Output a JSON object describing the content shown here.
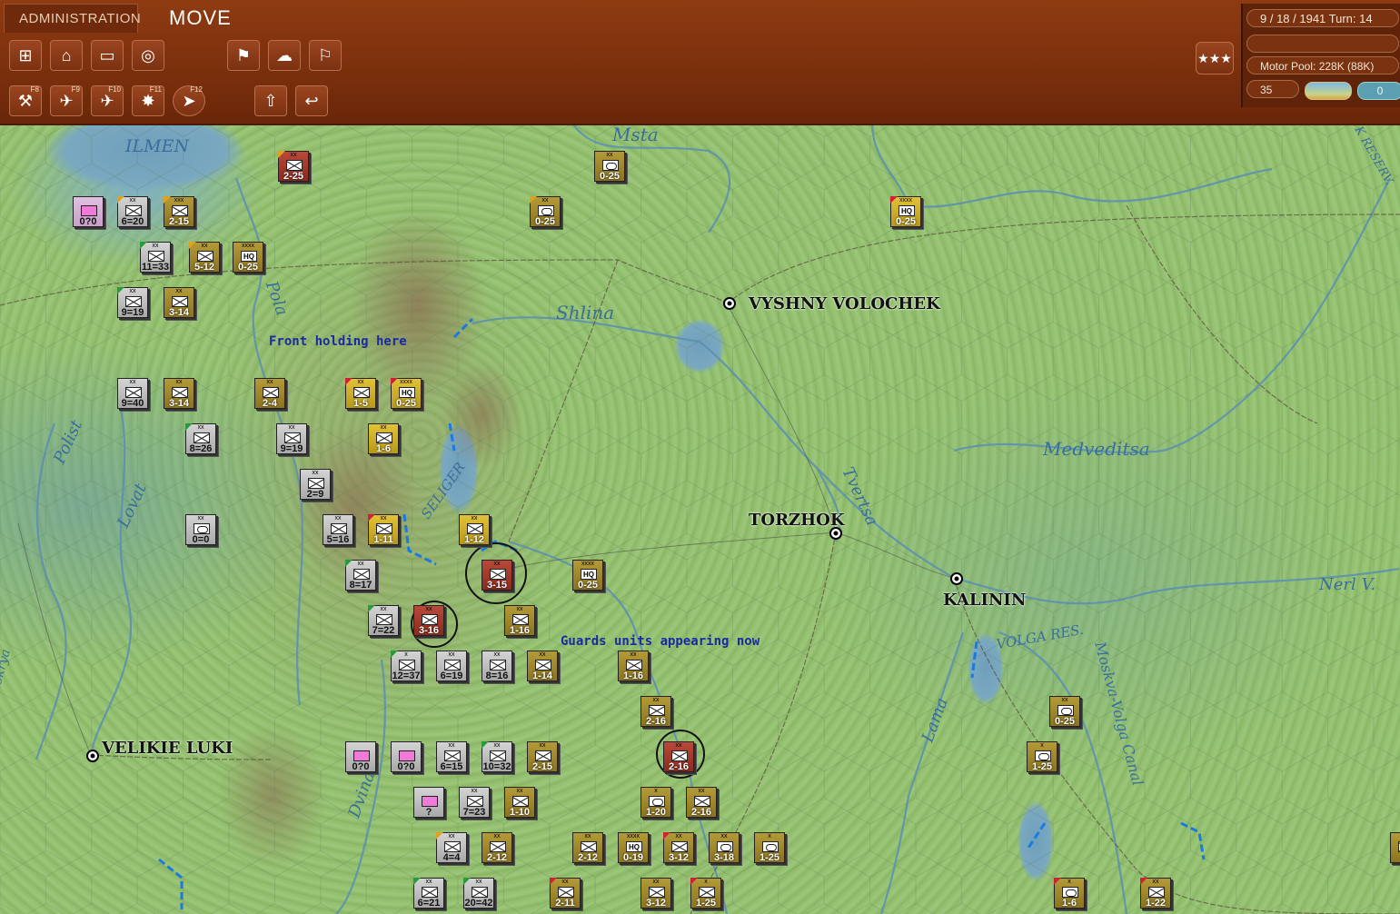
{
  "header": {
    "admin_tab": "ADMINISTRATION",
    "mode": "MOVE",
    "toolbar_row1": [
      {
        "name": "select-unit-icon",
        "glyph": "⊞"
      },
      {
        "name": "industry-icon",
        "glyph": "⌂"
      },
      {
        "name": "map-frame-icon",
        "glyph": "▭"
      },
      {
        "name": "zoom-target-icon",
        "glyph": "◎"
      },
      {
        "name": "reports-flag-icon",
        "glyph": "⚑"
      },
      {
        "name": "weather-icon",
        "glyph": "☁"
      },
      {
        "name": "victory-flag-icon",
        "glyph": "⚐"
      }
    ],
    "toolbar_row2": [
      {
        "name": "ground-attack-icon",
        "glyph": "⚒",
        "key": "F8"
      },
      {
        "name": "airborne-icon",
        "glyph": "✈",
        "key": "F9"
      },
      {
        "name": "air-strike-icon",
        "glyph": "✈",
        "key": "F10"
      },
      {
        "name": "bombard-icon",
        "glyph": "✸",
        "key": "F11"
      },
      {
        "name": "move-mode-icon",
        "glyph": "➤",
        "key": "F12"
      },
      {
        "name": "upload-icon",
        "glyph": "⇧",
        "key": ""
      },
      {
        "name": "undo-icon",
        "glyph": "↩",
        "key": ""
      }
    ],
    "stars": "★★★"
  },
  "info": {
    "turn": "9 / 18 / 1941  Turn: 14",
    "blank": "",
    "motor_pool": "Motor Pool:  228K (88K)",
    "number": "35",
    "water": "0"
  },
  "map": {
    "cities": [
      {
        "id": "vyshny-volochek",
        "label": "VYSHNY VOLOCHEK"
      },
      {
        "id": "torzhok",
        "label": "TORZHOK"
      },
      {
        "id": "kalinin",
        "label": "KALININ"
      },
      {
        "id": "velikie-luki",
        "label": "VELIKIE LUKI"
      }
    ],
    "rivers": [
      {
        "id": "ilmen",
        "label": "ILMEN"
      },
      {
        "id": "msta",
        "label": "Msta"
      },
      {
        "id": "shlina",
        "label": "Shlina"
      },
      {
        "id": "pola",
        "label": "Pola"
      },
      {
        "id": "polist",
        "label": "Polist"
      },
      {
        "id": "lovat",
        "label": "Lovat"
      },
      {
        "id": "seliger",
        "label": "SELIGER"
      },
      {
        "id": "tvertsa",
        "label": "Tvertsa"
      },
      {
        "id": "medveditsa",
        "label": "Medveditsa"
      },
      {
        "id": "nerl",
        "label": "Nerl V."
      },
      {
        "id": "volga",
        "label": "VOLGA RES."
      },
      {
        "id": "moskva-volga",
        "label": "Moskva-Volga Canal"
      },
      {
        "id": "lama",
        "label": "Lama"
      },
      {
        "id": "dvina",
        "label": "Dvina"
      },
      {
        "id": "rybinsk",
        "label": "K RESERV."
      },
      {
        "id": "lokrya",
        "label": "okrya"
      }
    ],
    "notes": [
      "Front holding here",
      "Guards units appearing now"
    ],
    "units": [
      {
        "c": "red",
        "t": "inf",
        "s": "2-25",
        "sz": "xx",
        "f": "gold"
      },
      {
        "c": "olive",
        "t": "arm",
        "s": "0-25",
        "sz": "xx",
        "f": ""
      },
      {
        "c": "pink",
        "t": "pink",
        "s": "0?0",
        "sz": "",
        "f": ""
      },
      {
        "c": "gray",
        "t": "inf",
        "s": "6=20",
        "sz": "xx",
        "f": "gold"
      },
      {
        "c": "olive",
        "t": "inf",
        "s": "2-15",
        "sz": "xxx",
        "f": "gold"
      },
      {
        "c": "olive",
        "t": "arm",
        "s": "0-25",
        "sz": "xx",
        "f": "gold"
      },
      {
        "c": "yellow",
        "t": "hq",
        "s": "0-25",
        "sz": "xxxx",
        "f": "red"
      },
      {
        "c": "gray",
        "t": "inf",
        "s": "11=33",
        "sz": "xx",
        "f": "green"
      },
      {
        "c": "olive",
        "t": "inf",
        "s": "5-12",
        "sz": "xx",
        "f": "gold"
      },
      {
        "c": "olive",
        "t": "hq",
        "s": "0-25",
        "sz": "xxxx",
        "f": ""
      },
      {
        "c": "gray",
        "t": "inf",
        "s": "9=19",
        "sz": "xx",
        "f": "green"
      },
      {
        "c": "olive",
        "t": "inf",
        "s": "3-14",
        "sz": "xx",
        "f": ""
      },
      {
        "c": "gray",
        "t": "inf",
        "s": "9=40",
        "sz": "xx",
        "f": ""
      },
      {
        "c": "olive",
        "t": "inf",
        "s": "3-14",
        "sz": "xx",
        "f": ""
      },
      {
        "c": "olive",
        "t": "inf",
        "s": "2-4",
        "sz": "xx",
        "f": ""
      },
      {
        "c": "yellow",
        "t": "inf",
        "s": "1-5",
        "sz": "xx",
        "f": "red"
      },
      {
        "c": "yellow",
        "t": "hq",
        "s": "0-25",
        "sz": "xxxx",
        "f": "red"
      },
      {
        "c": "gray",
        "t": "inf",
        "s": "8=26",
        "sz": "xx",
        "f": "green"
      },
      {
        "c": "gray",
        "t": "inf",
        "s": "9=19",
        "sz": "xx",
        "f": ""
      },
      {
        "c": "yellow",
        "t": "inf",
        "s": "1-6",
        "sz": "xx",
        "f": ""
      },
      {
        "c": "gray",
        "t": "inf",
        "s": "2=9",
        "sz": "xx",
        "f": ""
      },
      {
        "c": "gray",
        "t": "arm",
        "s": "0=0",
        "sz": "xx",
        "f": ""
      },
      {
        "c": "gray",
        "t": "inf",
        "s": "5=16",
        "sz": "xx",
        "f": ""
      },
      {
        "c": "yellow",
        "t": "inf",
        "s": "1-11",
        "sz": "xx",
        "f": "red"
      },
      {
        "c": "yellow",
        "t": "inf",
        "s": "1-12",
        "sz": "xx",
        "f": ""
      },
      {
        "c": "gray",
        "t": "inf",
        "s": "8=17",
        "sz": "xx",
        "f": "green"
      },
      {
        "c": "red",
        "t": "inf",
        "s": "3-15",
        "sz": "xx",
        "f": ""
      },
      {
        "c": "olive",
        "t": "hq",
        "s": "0-25",
        "sz": "xxxx",
        "f": ""
      },
      {
        "c": "gray",
        "t": "inf",
        "s": "7=22",
        "sz": "xx",
        "f": "green"
      },
      {
        "c": "red",
        "t": "inf",
        "s": "3-16",
        "sz": "xx",
        "f": ""
      },
      {
        "c": "olive",
        "t": "inf",
        "s": "1-16",
        "sz": "xx",
        "f": ""
      },
      {
        "c": "gray",
        "t": "inf",
        "s": "12=37",
        "sz": "x",
        "f": "green"
      },
      {
        "c": "gray",
        "t": "inf",
        "s": "6=19",
        "sz": "xx",
        "f": ""
      },
      {
        "c": "gray",
        "t": "inf",
        "s": "8=16",
        "sz": "xx",
        "f": ""
      },
      {
        "c": "olive",
        "t": "inf",
        "s": "1-14",
        "sz": "xx",
        "f": ""
      },
      {
        "c": "olive",
        "t": "inf",
        "s": "1-16",
        "sz": "xx",
        "f": ""
      },
      {
        "c": "olive",
        "t": "inf",
        "s": "2-16",
        "sz": "xx",
        "f": ""
      },
      {
        "c": "red",
        "t": "inf",
        "s": "2-16",
        "sz": "xx",
        "f": ""
      },
      {
        "c": "gray",
        "t": "pink",
        "s": "0?0",
        "sz": "",
        "f": ""
      },
      {
        "c": "gray",
        "t": "pink",
        "s": "0?0",
        "sz": "",
        "f": ""
      },
      {
        "c": "gray",
        "t": "inf",
        "s": "6=15",
        "sz": "xx",
        "f": ""
      },
      {
        "c": "gray",
        "t": "inf",
        "s": "10=32",
        "sz": "xx",
        "f": "green"
      },
      {
        "c": "olive",
        "t": "inf",
        "s": "2-15",
        "sz": "xx",
        "f": ""
      },
      {
        "c": "gray",
        "t": "pink",
        "s": "?",
        "sz": "",
        "f": ""
      },
      {
        "c": "gray",
        "t": "inf",
        "s": "7=23",
        "sz": "xx",
        "f": ""
      },
      {
        "c": "olive",
        "t": "inf",
        "s": "1-10",
        "sz": "xx",
        "f": ""
      },
      {
        "c": "olive",
        "t": "arm",
        "s": "1-20",
        "sz": "x",
        "f": ""
      },
      {
        "c": "olive",
        "t": "inf",
        "s": "2-16",
        "sz": "xx",
        "f": ""
      },
      {
        "c": "gray",
        "t": "inf",
        "s": "4=4",
        "sz": "xx",
        "f": "gold"
      },
      {
        "c": "olive",
        "t": "inf",
        "s": "2-12",
        "sz": "xx",
        "f": ""
      },
      {
        "c": "olive",
        "t": "inf",
        "s": "2-12",
        "sz": "xx",
        "f": ""
      },
      {
        "c": "olive",
        "t": "hq",
        "s": "0-19",
        "sz": "xxxx",
        "f": ""
      },
      {
        "c": "olive",
        "t": "inf",
        "s": "3-12",
        "sz": "xx",
        "f": "red"
      },
      {
        "c": "olive",
        "t": "arm",
        "s": "3-18",
        "sz": "xx",
        "f": ""
      },
      {
        "c": "olive",
        "t": "arm",
        "s": "1-25",
        "sz": "x",
        "f": ""
      },
      {
        "c": "gray",
        "t": "inf",
        "s": "6=21",
        "sz": "xx",
        "f": "green"
      },
      {
        "c": "gray",
        "t": "inf",
        "s": "20=42",
        "sz": "xx",
        "f": "green"
      },
      {
        "c": "olive",
        "t": "inf",
        "s": "2-11",
        "sz": "xx",
        "f": "red"
      },
      {
        "c": "olive",
        "t": "inf",
        "s": "3-12",
        "sz": "xx",
        "f": ""
      },
      {
        "c": "olive",
        "t": "inf",
        "s": "1-25",
        "sz": "x",
        "f": "red"
      },
      {
        "c": "olive",
        "t": "arm",
        "s": "0-25",
        "sz": "xx",
        "f": ""
      },
      {
        "c": "olive",
        "t": "arm",
        "s": "1-25",
        "sz": "x",
        "f": ""
      },
      {
        "c": "olive",
        "t": "arm",
        "s": "1-6",
        "sz": "x",
        "f": "red"
      },
      {
        "c": "olive",
        "t": "inf",
        "s": "1-22",
        "sz": "xx",
        "f": "red"
      },
      {
        "c": "olive",
        "t": "inf",
        "s": "",
        "sz": "",
        "f": ""
      }
    ]
  }
}
